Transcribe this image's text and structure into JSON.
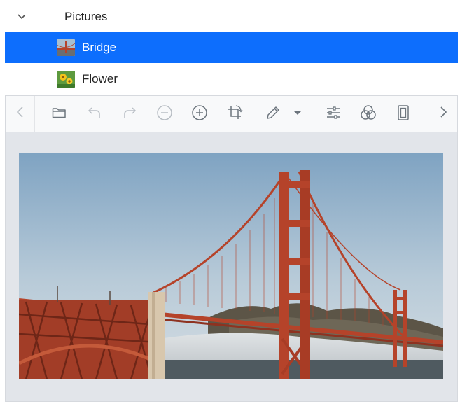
{
  "tree": {
    "parent": {
      "label": "Pictures",
      "expanded": true
    },
    "items": [
      {
        "label": "Bridge",
        "selected": true,
        "thumbnail": "bridge-thumbnail"
      },
      {
        "label": "Flower",
        "selected": false,
        "thumbnail": "flower-thumbnail"
      }
    ]
  },
  "toolbar": {
    "buttons": [
      {
        "icon": "chevron-left-icon"
      },
      {
        "icon": "open-folder-icon"
      },
      {
        "icon": "undo-icon"
      },
      {
        "icon": "redo-icon"
      },
      {
        "icon": "zoom-out-icon"
      },
      {
        "icon": "zoom-in-icon"
      },
      {
        "icon": "crop-rotate-icon"
      },
      {
        "icon": "pencil-icon"
      },
      {
        "icon": "caret-down-icon"
      },
      {
        "icon": "sliders-icon"
      },
      {
        "icon": "color-circles-icon"
      },
      {
        "icon": "frame-icon"
      },
      {
        "icon": "chevron-right-icon"
      }
    ]
  },
  "colors": {
    "selection": "#0d6efd",
    "toolbar_bg": "#f8f9fa",
    "viewer_bg": "#e2e5ea",
    "icon": "#6c757d",
    "icon_disabled": "#b8bec4",
    "bridge": "#b5432a"
  }
}
